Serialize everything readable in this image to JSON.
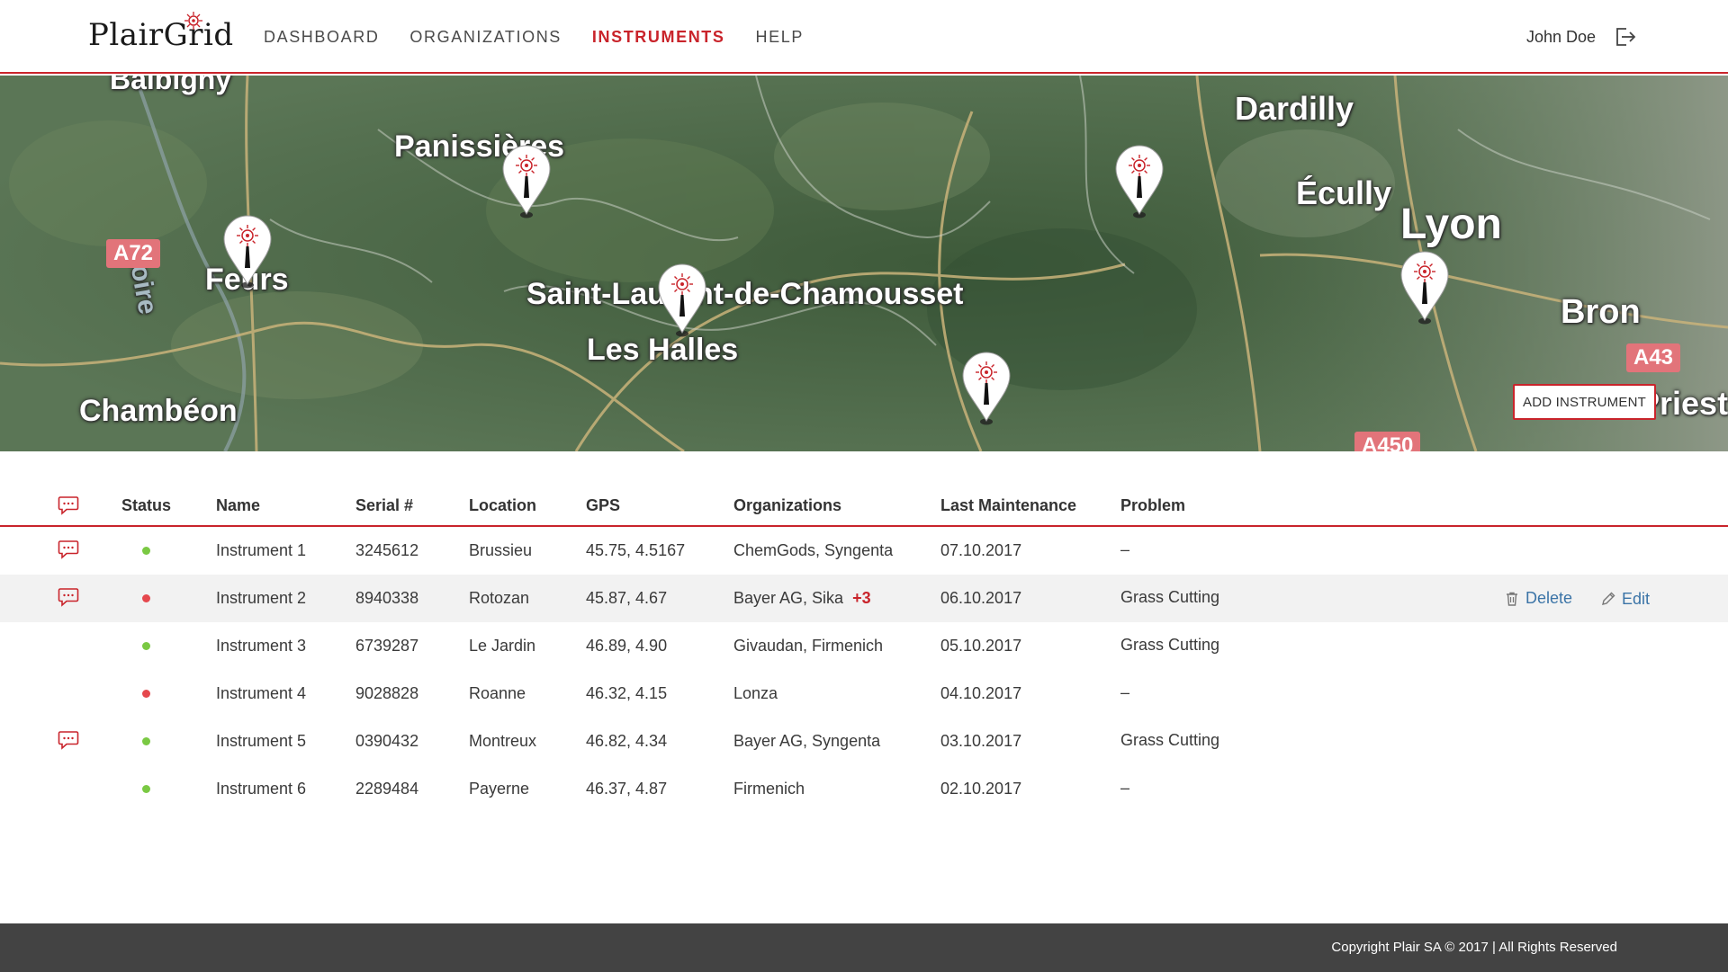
{
  "header": {
    "logo_text": "PlairGrid",
    "nav": [
      {
        "label": "DASHBOARD",
        "active": false
      },
      {
        "label": "ORGANIZATIONS",
        "active": false
      },
      {
        "label": "INSTRUMENTS",
        "active": true
      },
      {
        "label": "HELP",
        "active": false
      }
    ],
    "user_name": "John Doe"
  },
  "map": {
    "place_labels": [
      "Balbigny",
      "Panissières",
      "Dardilly",
      "Écully",
      "Lyon",
      "Feurs",
      "Saint-Laurent-de-Chamousset",
      "Les Halles",
      "Bron",
      "Chambéon",
      "Priest",
      "Loire"
    ],
    "road_shields": [
      "A72",
      "A43",
      "A450"
    ],
    "add_button_label": "ADD INSTRUMENT"
  },
  "table": {
    "columns": {
      "status": "Status",
      "name": "Name",
      "serial": "Serial #",
      "location": "Location",
      "gps": "GPS",
      "organizations": "Organizations",
      "last_maintenance": "Last Maintenance",
      "problem": "Problem"
    },
    "rows": [
      {
        "comment": true,
        "status": "ok",
        "name": "Instrument 1",
        "serial": "3245612",
        "location": "Brussieu",
        "gps": "45.75, 4.5167",
        "organizations": "ChemGods, Syngenta",
        "extra": "",
        "last_maintenance": "07.10.2017",
        "problem": "–"
      },
      {
        "comment": true,
        "status": "error",
        "name": "Instrument 2",
        "serial": "8940338",
        "location": "Rotozan",
        "gps": "45.87, 4.67",
        "organizations": "Bayer AG, Sika",
        "extra": "+3",
        "last_maintenance": "06.10.2017",
        "problem": "Grass Cutting"
      },
      {
        "comment": false,
        "status": "ok",
        "name": "Instrument 3",
        "serial": "6739287",
        "location": "Le Jardin",
        "gps": "46.89, 4.90",
        "organizations": "Givaudan, Firmenich",
        "extra": "",
        "last_maintenance": "05.10.2017",
        "problem": "Grass Cutting"
      },
      {
        "comment": false,
        "status": "error",
        "name": "Instrument 4",
        "serial": "9028828",
        "location": "Roanne",
        "gps": "46.32, 4.15",
        "organizations": "Lonza",
        "extra": "",
        "last_maintenance": "04.10.2017",
        "problem": "–"
      },
      {
        "comment": true,
        "status": "ok",
        "name": "Instrument 5",
        "serial": "0390432",
        "location": "Montreux",
        "gps": "46.82, 4.34",
        "organizations": "Bayer AG, Syngenta",
        "extra": "",
        "last_maintenance": "03.10.2017",
        "problem": "Grass Cutting"
      },
      {
        "comment": false,
        "status": "ok",
        "name": "Instrument 6",
        "serial": "2289484",
        "location": "Payerne",
        "gps": "46.37, 4.87",
        "organizations": "Firmenich",
        "extra": "",
        "last_maintenance": "02.10.2017",
        "problem": "–"
      }
    ],
    "row_actions": {
      "delete_label": "Delete",
      "edit_label": "Edit"
    }
  },
  "footer": {
    "copyright": "Copyright Plair SA © 2017 | All Rights Reserved"
  },
  "colors": {
    "brand_red": "#c9242b",
    "status_ok": "#7ac943",
    "status_error": "#e5484d",
    "link_blue": "#3b74a7",
    "footer_bg": "#434343"
  },
  "icons": {
    "comment": "speech-bubble-icon",
    "logout": "logout-icon",
    "pin": "instrument-pin-icon",
    "delete": "trash-icon",
    "edit": "pencil-icon"
  }
}
